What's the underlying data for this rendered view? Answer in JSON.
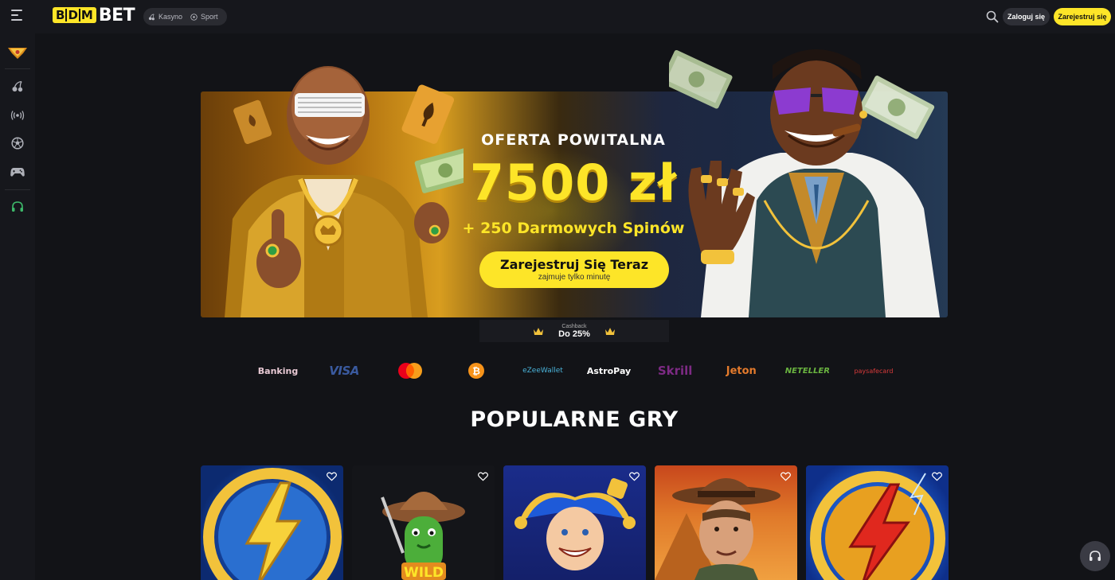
{
  "header": {
    "logo_letters": [
      "B",
      "D",
      "M"
    ],
    "logo_word": "BET",
    "modes": [
      {
        "label": "Kasyno",
        "icon": "cherries-icon"
      },
      {
        "label": "Sport",
        "icon": "soccer-ball-icon"
      }
    ],
    "login_label": "Zaloguj się",
    "register_label": "Zarejestruj się"
  },
  "sidebar": {
    "items": [
      {
        "name": "vip-crown-icon"
      },
      {
        "name": "cherries-icon"
      },
      {
        "name": "live-broadcast-icon"
      },
      {
        "name": "soccer-ball-icon"
      },
      {
        "name": "gamepad-icon"
      },
      {
        "name": "headset-icon"
      }
    ]
  },
  "hero": {
    "offer_label": "OFERTA POWITALNA",
    "amount": "7500 zł",
    "spins": "+ 250 Darmowych Spinów",
    "cta_label": "Zarejestruj Się Teraz",
    "cta_sub": "zajmuje tylko minutę"
  },
  "cashback": {
    "label": "Cashback",
    "value": "Do 25%"
  },
  "payments": [
    {
      "label": "Banking",
      "color": "#e8c9d4"
    },
    {
      "label": "VISA",
      "color": "#3a5a9f"
    },
    {
      "label": "mastercard",
      "color": "#eb001b"
    },
    {
      "label": "bitcoin",
      "color": "#f7931a"
    },
    {
      "label": "eZeeWallet",
      "color": "#4ab3d9"
    },
    {
      "label": "AstroPay",
      "color": "#ffffff"
    },
    {
      "label": "Skrill",
      "color": "#7d2a84"
    },
    {
      "label": "Jeton",
      "color": "#e37a2c"
    },
    {
      "label": "NETELLER",
      "color": "#6ab440"
    },
    {
      "label": "paysafecard",
      "color": "#d83a3a"
    }
  ],
  "popular": {
    "title": "POPULARNE GRY"
  },
  "games": [
    {
      "name": "lightning-coin-blue"
    },
    {
      "name": "cactus-cowboy-wild"
    },
    {
      "name": "jester-joker"
    },
    {
      "name": "book-of-ra-explorer"
    },
    {
      "name": "lightning-coin-red"
    }
  ],
  "colors": {
    "accent": "#fde528",
    "background": "#121317",
    "sidebar": "#16171c"
  }
}
